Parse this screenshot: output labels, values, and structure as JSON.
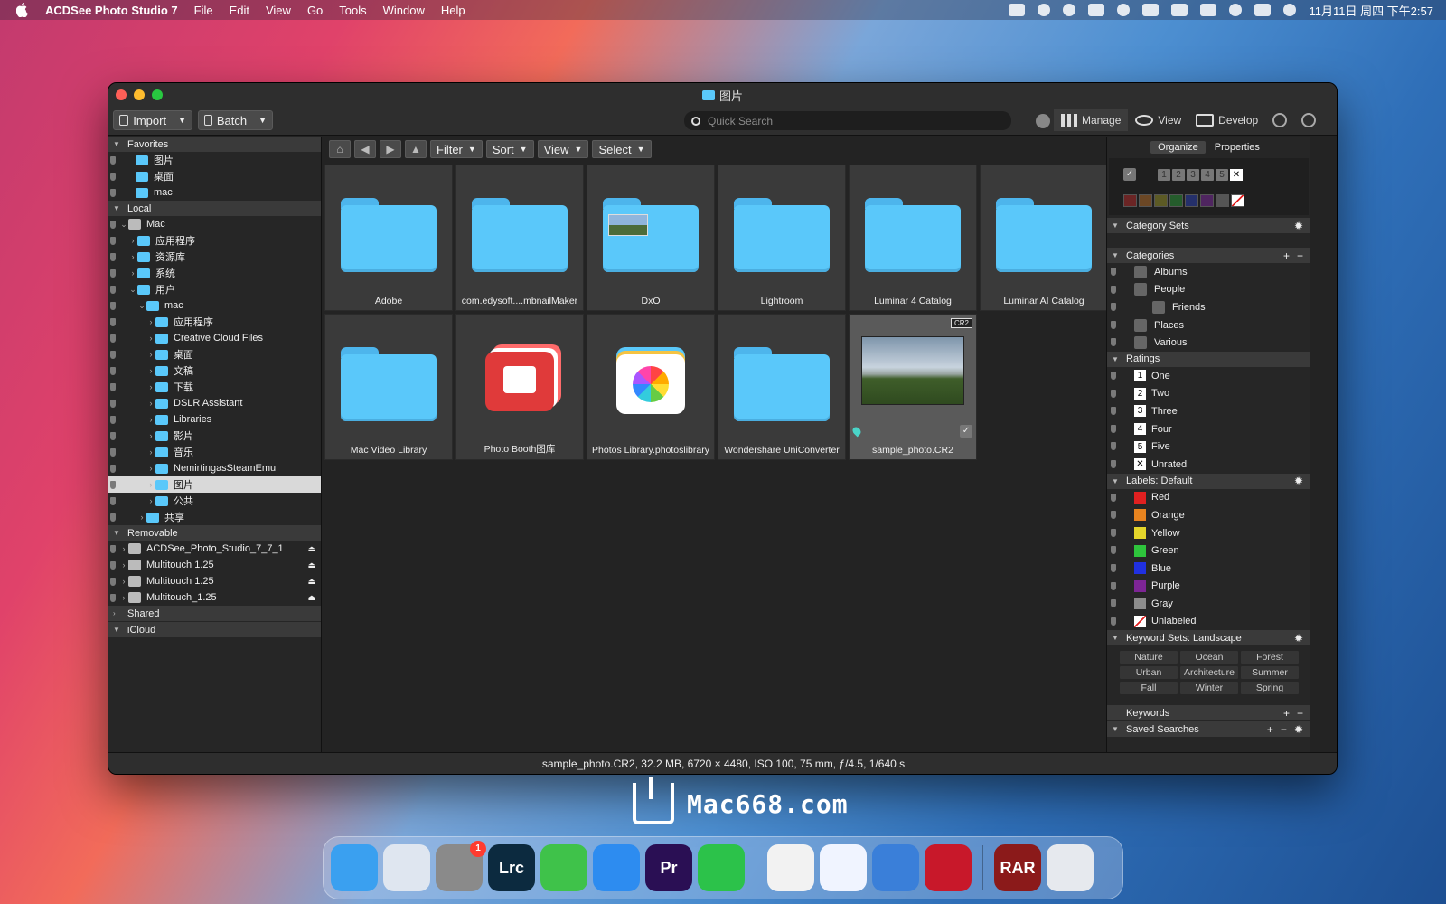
{
  "menubar": {
    "app_name": "ACDSee Photo Studio 7",
    "items": [
      "File",
      "Edit",
      "View",
      "Go",
      "Tools",
      "Window",
      "Help"
    ],
    "clock": "11月11日 周四 下午2:57"
  },
  "window": {
    "title": "图片",
    "import_label": "Import",
    "batch_label": "Batch",
    "search_placeholder": "Quick Search",
    "modes": [
      "Manage",
      "View",
      "Develop"
    ]
  },
  "sidebar": {
    "sections": {
      "favorites": "Favorites",
      "local": "Local",
      "removable": "Removable",
      "shared": "Shared",
      "icloud": "iCloud"
    },
    "favorites": [
      "图片",
      "桌面",
      "mac"
    ],
    "local": [
      {
        "label": "Mac",
        "level": 0,
        "icon": "drive",
        "expanded": true
      },
      {
        "label": "应用程序",
        "level": 1,
        "icon": "folder"
      },
      {
        "label": "资源库",
        "level": 1,
        "icon": "folder"
      },
      {
        "label": "系统",
        "level": 1,
        "icon": "folder"
      },
      {
        "label": "用户",
        "level": 1,
        "icon": "folder",
        "expanded": true
      },
      {
        "label": "mac",
        "level": 2,
        "icon": "folder",
        "expanded": true
      },
      {
        "label": "应用程序",
        "level": 3,
        "icon": "folder"
      },
      {
        "label": "Creative Cloud Files",
        "level": 3,
        "icon": "folder"
      },
      {
        "label": "桌面",
        "level": 3,
        "icon": "folder"
      },
      {
        "label": "文稿",
        "level": 3,
        "icon": "folder"
      },
      {
        "label": "下载",
        "level": 3,
        "icon": "folder"
      },
      {
        "label": "DSLR Assistant",
        "level": 3,
        "icon": "folder"
      },
      {
        "label": "Libraries",
        "level": 3,
        "icon": "folder"
      },
      {
        "label": "影片",
        "level": 3,
        "icon": "folder"
      },
      {
        "label": "音乐",
        "level": 3,
        "icon": "folder"
      },
      {
        "label": "NemirtingasSteamEmu",
        "level": 3,
        "icon": "folder"
      },
      {
        "label": "图片",
        "level": 3,
        "icon": "folder",
        "selected": true
      },
      {
        "label": "公共",
        "level": 3,
        "icon": "folder"
      },
      {
        "label": "共享",
        "level": 2,
        "icon": "folder"
      }
    ],
    "removable": [
      "ACDSee_Photo_Studio_7_7_1",
      "Multitouch 1.25",
      "Multitouch 1.25",
      "Multitouch_1.25"
    ]
  },
  "browser": {
    "nav": {
      "filter": "Filter",
      "sort": "Sort",
      "view": "View",
      "select": "Select"
    },
    "items": [
      {
        "name": "Adobe",
        "type": "folder"
      },
      {
        "name": "com.edysoft....mbnailMaker",
        "type": "folder"
      },
      {
        "name": "DxO",
        "type": "folder-thumb"
      },
      {
        "name": "Lightroom",
        "type": "folder"
      },
      {
        "name": "Luminar 4 Catalog",
        "type": "folder"
      },
      {
        "name": "Luminar AI Catalog",
        "type": "folder"
      },
      {
        "name": "Mac Video Library",
        "type": "folder"
      },
      {
        "name": "Photo Booth图库",
        "type": "photobooth"
      },
      {
        "name": "Photos Library.photoslibrary",
        "type": "photos"
      },
      {
        "name": "Wondershare UniConverter",
        "type": "folder"
      },
      {
        "name": "sample_photo.CR2",
        "type": "photo",
        "badge": "CR2",
        "selected": true
      }
    ],
    "zoom_level": 0.5
  },
  "rpanel": {
    "tabs": [
      "Organize",
      "Properties"
    ],
    "rating_filters": [
      "1",
      "2",
      "3",
      "4",
      "5",
      "✕"
    ],
    "label_filter_colors": [
      "#6b2525",
      "#6b4725",
      "#5c5a25",
      "#255c2c",
      "#25306b",
      "#4f2560",
      "#555555"
    ],
    "category_sets": "Category Sets",
    "categories_head": "Categories",
    "categories": [
      {
        "label": "Albums",
        "level": 0
      },
      {
        "label": "People",
        "level": 0
      },
      {
        "label": "Friends",
        "level": 1
      },
      {
        "label": "Places",
        "level": 0
      },
      {
        "label": "Various",
        "level": 0
      }
    ],
    "ratings_head": "Ratings",
    "ratings": [
      {
        "num": "1",
        "label": "One"
      },
      {
        "num": "2",
        "label": "Two"
      },
      {
        "num": "3",
        "label": "Three"
      },
      {
        "num": "4",
        "label": "Four"
      },
      {
        "num": "5",
        "label": "Five"
      },
      {
        "num": "✕",
        "label": "Unrated"
      }
    ],
    "labels_head": "Labels: Default",
    "labels": [
      {
        "label": "Red",
        "color": "#e02020"
      },
      {
        "label": "Orange",
        "color": "#e8841f"
      },
      {
        "label": "Yellow",
        "color": "#e5d62b"
      },
      {
        "label": "Green",
        "color": "#2ec43c"
      },
      {
        "label": "Blue",
        "color": "#2030e0"
      },
      {
        "label": "Purple",
        "color": "#7d2595"
      },
      {
        "label": "Gray",
        "color": "#8c8c8c"
      },
      {
        "label": "Unlabeled",
        "color": "none"
      }
    ],
    "keyword_sets_head": "Keyword Sets: Landscape",
    "keyword_sets": [
      "Nature",
      "Ocean",
      "Forest",
      "Urban",
      "Architecture",
      "Summer",
      "Fall",
      "Winter",
      "Spring"
    ],
    "keywords_head": "Keywords",
    "saved_searches_head": "Saved Searches"
  },
  "status": "sample_photo.CR2, 32.2 MB, 6720 × 4480, ISO 100, 75 mm, ƒ/4.5, 1/640 s",
  "watermark": "Mac668.com",
  "dock": [
    {
      "name": "finder",
      "color": "#3aa0f0"
    },
    {
      "name": "launchpad",
      "color": "#dfe6f0"
    },
    {
      "name": "system-preferences",
      "color": "#8a8a8a",
      "badge": "1"
    },
    {
      "name": "lightroom-classic",
      "color": "#0c2a3f",
      "text": "Lrc"
    },
    {
      "name": "marker",
      "color": "#3fc24a"
    },
    {
      "name": "safari",
      "color": "#2d8cf0"
    },
    {
      "name": "premiere",
      "color": "#2a0f54",
      "text": "Pr"
    },
    {
      "name": "wechat",
      "color": "#2cc24a"
    },
    {
      "name": "chrome",
      "color": "#f2f2f2"
    },
    {
      "name": "baidu-netdisk",
      "color": "#f0f4ff"
    },
    {
      "name": "rocket",
      "color": "#3a7fd9"
    },
    {
      "name": "acdsee",
      "color": "#c8182a"
    },
    {
      "name": "rar",
      "color": "#8b1a1a",
      "text": "RAR"
    },
    {
      "name": "trash",
      "color": "#e6e9ee"
    }
  ]
}
